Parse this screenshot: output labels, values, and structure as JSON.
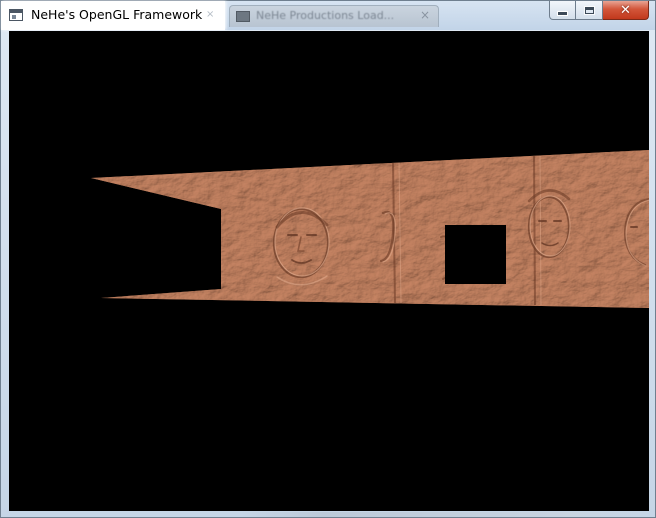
{
  "window": {
    "title": "NeHe's OpenGL Framework",
    "background_tab_title": "NeHe Productions Load...",
    "buttons": {
      "minimize": "minimize",
      "maximize": "maximize",
      "close": "close"
    }
  },
  "scene": {
    "background_color": "#000000",
    "wall_color": "#b06f50",
    "wall_texture": "embossed-faces",
    "hole_color": "#000000"
  },
  "icons": {
    "app": "application-icon",
    "close": "close-icon",
    "minimize": "minimize-icon",
    "maximize": "maximize-icon"
  }
}
